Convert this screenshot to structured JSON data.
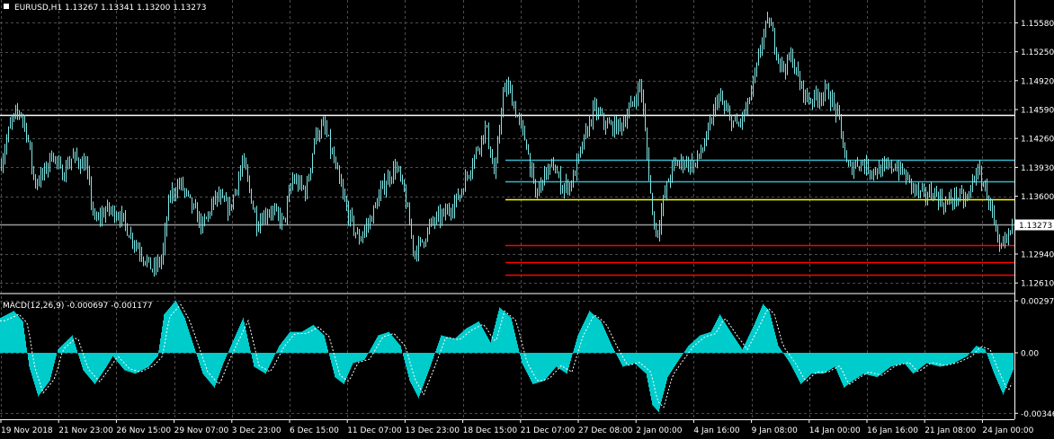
{
  "chart_data": [
    {
      "type": "candlestick",
      "title": "EURUSD,H1  1.13267 1.13341 1.13200 1.13273",
      "symbol": "EURUSD",
      "timeframe": "H1",
      "ohlc": {
        "open": 1.13267,
        "high": 1.13341,
        "low": 1.132,
        "close": 1.13273
      },
      "last_price_label": "1.13273",
      "y_ticks": [
        "1.15580",
        "1.15250",
        "1.14920",
        "1.14590",
        "1.14260",
        "1.13930",
        "1.13600",
        "1.12940",
        "1.12610"
      ],
      "ylim": [
        1.1254,
        1.158
      ],
      "x_ticks": [
        "19 Nov 2018",
        "21 Nov 23:00",
        "26 Nov 15:00",
        "29 Nov 07:00",
        "3 Dec 23:00",
        "6 Dec 15:00",
        "11 Dec 07:00",
        "13 Dec 23:00",
        "18 Dec 15:00",
        "21 Dec 07:00",
        "27 Dec 08:00",
        "2 Jan 00:00",
        "4 Jan 16:00",
        "9 Jan 08:00",
        "14 Jan 00:00",
        "16 Jan 16:00",
        "21 Jan 08:00",
        "24 Jan 00:00"
      ],
      "price_path": [
        [
          0,
          1.1395
        ],
        [
          12,
          1.1445
        ],
        [
          22,
          1.1458
        ],
        [
          30,
          1.143
        ],
        [
          38,
          1.1375
        ],
        [
          48,
          1.1385
        ],
        [
          58,
          1.141
        ],
        [
          68,
          1.1385
        ],
        [
          80,
          1.1405
        ],
        [
          95,
          1.1395
        ],
        [
          105,
          1.133
        ],
        [
          118,
          1.1345
        ],
        [
          132,
          1.134
        ],
        [
          145,
          1.1315
        ],
        [
          160,
          1.129
        ],
        [
          170,
          1.1275
        ],
        [
          180,
          1.129
        ],
        [
          188,
          1.136
        ],
        [
          200,
          1.1375
        ],
        [
          212,
          1.135
        ],
        [
          225,
          1.1325
        ],
        [
          240,
          1.136
        ],
        [
          255,
          1.1345
        ],
        [
          270,
          1.14
        ],
        [
          285,
          1.133
        ],
        [
          300,
          1.1345
        ],
        [
          315,
          1.133
        ],
        [
          325,
          1.138
        ],
        [
          340,
          1.1365
        ],
        [
          350,
          1.143
        ],
        [
          360,
          1.144
        ],
        [
          372,
          1.1395
        ],
        [
          385,
          1.1345
        ],
        [
          398,
          1.131
        ],
        [
          410,
          1.133
        ],
        [
          425,
          1.137
        ],
        [
          440,
          1.1395
        ],
        [
          450,
          1.136
        ],
        [
          460,
          1.1295
        ],
        [
          470,
          1.131
        ],
        [
          480,
          1.133
        ],
        [
          495,
          1.134
        ],
        [
          510,
          1.136
        ],
        [
          525,
          1.14
        ],
        [
          540,
          1.144
        ],
        [
          550,
          1.138
        ],
        [
          558,
          1.1475
        ],
        [
          565,
          1.1485
        ],
        [
          575,
          1.145
        ],
        [
          585,
          1.142
        ],
        [
          595,
          1.136
        ],
        [
          605,
          1.1385
        ],
        [
          615,
          1.1395
        ],
        [
          625,
          1.137
        ],
        [
          635,
          1.1375
        ],
        [
          648,
          1.142
        ],
        [
          660,
          1.146
        ],
        [
          675,
          1.144
        ],
        [
          690,
          1.144
        ],
        [
          705,
          1.147
        ],
        [
          712,
          1.149
        ],
        [
          718,
          1.142
        ],
        [
          725,
          1.134
        ],
        [
          730,
          1.1315
        ],
        [
          738,
          1.136
        ],
        [
          748,
          1.1395
        ],
        [
          760,
          1.14
        ],
        [
          772,
          1.1395
        ],
        [
          785,
          1.1425
        ],
        [
          798,
          1.1475
        ],
        [
          810,
          1.145
        ],
        [
          820,
          1.144
        ],
        [
          830,
          1.146
        ],
        [
          840,
          1.15
        ],
        [
          848,
          1.1545
        ],
        [
          855,
          1.156
        ],
        [
          862,
          1.153
        ],
        [
          870,
          1.1505
        ],
        [
          880,
          1.152
        ],
        [
          888,
          1.149
        ],
        [
          898,
          1.147
        ],
        [
          910,
          1.1475
        ],
        [
          920,
          1.148
        ],
        [
          932,
          1.145
        ],
        [
          942,
          1.139
        ],
        [
          955,
          1.14
        ],
        [
          968,
          1.139
        ],
        [
          980,
          1.139
        ],
        [
          995,
          1.1395
        ],
        [
          1005,
          1.1385
        ],
        [
          1015,
          1.137
        ],
        [
          1025,
          1.136
        ],
        [
          1038,
          1.1365
        ],
        [
          1050,
          1.135
        ],
        [
          1062,
          1.136
        ],
        [
          1075,
          1.1355
        ],
        [
          1085,
          1.139
        ],
        [
          1095,
          1.137
        ],
        [
          1102,
          1.1345
        ],
        [
          1110,
          1.1295
        ],
        [
          1118,
          1.131
        ],
        [
          1126,
          1.1327
        ]
      ],
      "horizontal_levels": [
        {
          "price": 1.1453,
          "color": "#ffffff",
          "from_x": 0
        },
        {
          "price": 1.1328,
          "color": "#9a9a9a",
          "from_x": 0
        },
        {
          "price": 1.1402,
          "color": "#35b8c8",
          "from_x": 562
        },
        {
          "price": 1.1377,
          "color": "#35b8c8",
          "from_x": 562
        },
        {
          "price": 1.1357,
          "color": "#ffff00",
          "from_x": 562
        },
        {
          "price": 1.1304,
          "color": "#ff0000",
          "from_x": 562
        },
        {
          "price": 1.1285,
          "color": "#ff0000",
          "from_x": 562
        },
        {
          "price": 1.127,
          "color": "#ff0000",
          "from_x": 562
        }
      ],
      "colors": {
        "background": "#000000",
        "grid": "#4c4c4c",
        "candles": "#7fe6e6",
        "axis": "#ffffff"
      }
    },
    {
      "type": "histogram",
      "title": "MACD(12,26,9) -0.000697 -0.001177",
      "y_ticks": [
        "0.002979",
        "0.00",
        "-0.003463"
      ],
      "ylim": [
        -0.00355,
        0.00298
      ],
      "macd_path": [
        [
          0,
          0.002
        ],
        [
          15,
          0.0024
        ],
        [
          25,
          0.0018
        ],
        [
          32,
          -0.0008
        ],
        [
          42,
          -0.0025
        ],
        [
          55,
          -0.0016
        ],
        [
          64,
          0.0002
        ],
        [
          80,
          0.001
        ],
        [
          92,
          -0.001
        ],
        [
          105,
          -0.0018
        ],
        [
          118,
          -0.0008
        ],
        [
          125,
          -0.0002
        ],
        [
          138,
          -0.001
        ],
        [
          150,
          -0.0012
        ],
        [
          165,
          -0.0008
        ],
        [
          175,
          -0.0002
        ],
        [
          182,
          0.0022
        ],
        [
          195,
          0.003
        ],
        [
          205,
          0.002
        ],
        [
          215,
          0.0004
        ],
        [
          225,
          -0.0012
        ],
        [
          238,
          -0.002
        ],
        [
          248,
          -0.0006
        ],
        [
          258,
          0.0006
        ],
        [
          270,
          0.002
        ],
        [
          282,
          -0.0008
        ],
        [
          295,
          -0.0012
        ],
        [
          310,
          0.0004
        ],
        [
          322,
          0.0012
        ],
        [
          335,
          0.0012
        ],
        [
          348,
          0.0016
        ],
        [
          360,
          0.001
        ],
        [
          372,
          -0.0014
        ],
        [
          382,
          -0.0018
        ],
        [
          392,
          -0.0006
        ],
        [
          405,
          -0.0004
        ],
        [
          420,
          0.001
        ],
        [
          432,
          0.0012
        ],
        [
          445,
          0.0004
        ],
        [
          455,
          -0.0016
        ],
        [
          465,
          -0.0026
        ],
        [
          478,
          -0.0008
        ],
        [
          490,
          0.001
        ],
        [
          505,
          0.0008
        ],
        [
          518,
          0.0014
        ],
        [
          532,
          0.0018
        ],
        [
          545,
          0.0006
        ],
        [
          555,
          0.0026
        ],
        [
          568,
          0.002
        ],
        [
          580,
          -0.0006
        ],
        [
          592,
          -0.0018
        ],
        [
          605,
          -0.0016
        ],
        [
          618,
          -0.0008
        ],
        [
          630,
          -0.0012
        ],
        [
          642,
          0.001
        ],
        [
          655,
          0.0024
        ],
        [
          668,
          0.0018
        ],
        [
          680,
          0.0004
        ],
        [
          692,
          -0.0008
        ],
        [
          705,
          -0.0006
        ],
        [
          718,
          -0.0012
        ],
        [
          725,
          -0.003
        ],
        [
          732,
          -0.0034
        ],
        [
          742,
          -0.0014
        ],
        [
          752,
          -0.0006
        ],
        [
          765,
          0.0004
        ],
        [
          778,
          0.001
        ],
        [
          790,
          0.0012
        ],
        [
          800,
          0.0022
        ],
        [
          812,
          0.0012
        ],
        [
          825,
          0.0002
        ],
        [
          838,
          0.0016
        ],
        [
          848,
          0.0028
        ],
        [
          855,
          0.0024
        ],
        [
          865,
          0.0004
        ],
        [
          878,
          -0.0006
        ],
        [
          890,
          -0.0018
        ],
        [
          902,
          -0.0012
        ],
        [
          915,
          -0.0012
        ],
        [
          928,
          -0.0008
        ],
        [
          938,
          -0.002
        ],
        [
          948,
          -0.0016
        ],
        [
          960,
          -0.0012
        ],
        [
          975,
          -0.0014
        ],
        [
          990,
          -0.0008
        ],
        [
          1005,
          -0.0006
        ],
        [
          1015,
          -0.0012
        ],
        [
          1030,
          -0.0006
        ],
        [
          1045,
          -0.0008
        ],
        [
          1060,
          -0.0006
        ],
        [
          1075,
          -0.0002
        ],
        [
          1085,
          0.0004
        ],
        [
          1095,
          0.0002
        ],
        [
          1105,
          -0.0012
        ],
        [
          1115,
          -0.0024
        ],
        [
          1126,
          -0.001
        ]
      ],
      "colors": {
        "histogram": "#00cccc",
        "signal": "#ffffff"
      }
    }
  ]
}
